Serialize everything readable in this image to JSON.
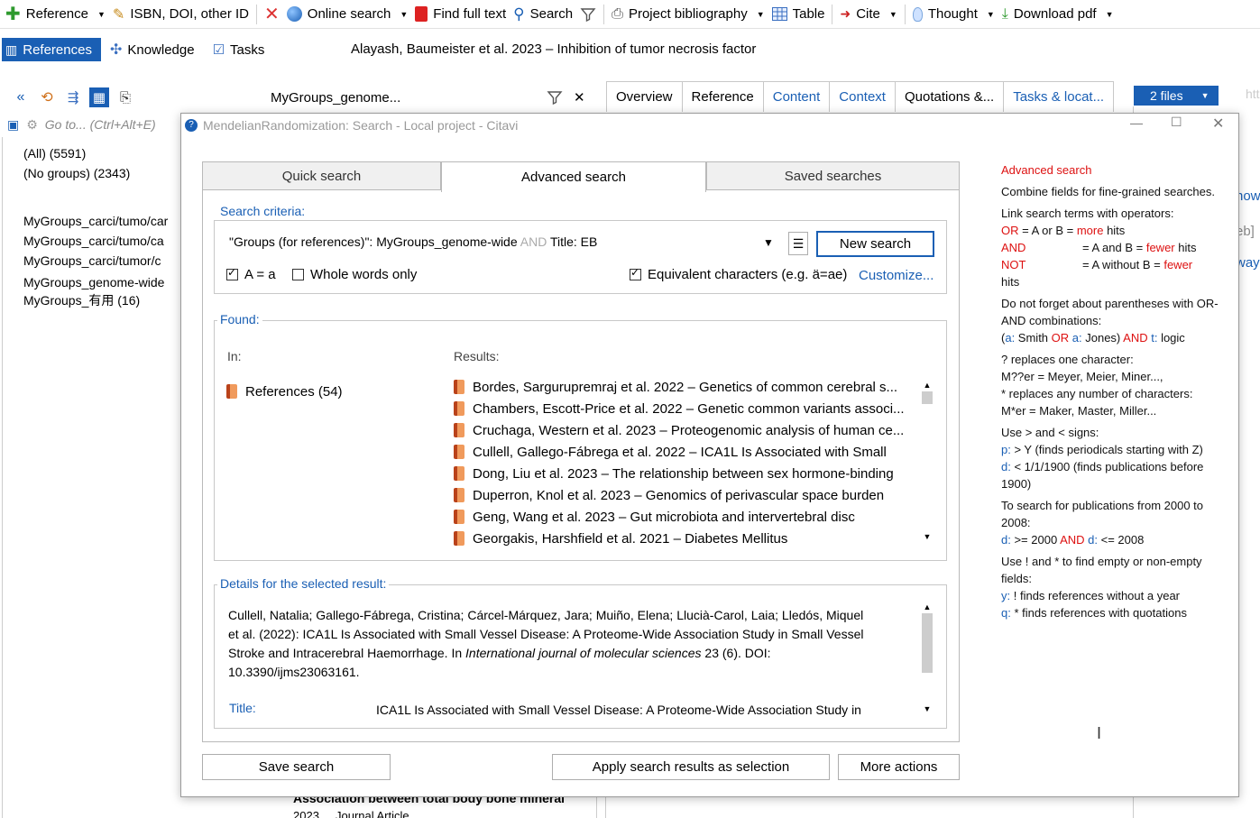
{
  "toolbar": {
    "items": [
      {
        "label": "Reference",
        "icon": "plus-icon",
        "caret": true
      },
      {
        "label": "ISBN, DOI, other ID",
        "icon": "wand-icon",
        "caret": false
      },
      {
        "label": "Online search",
        "icon": "globe-icon",
        "caret": true
      },
      {
        "label": "Find full text",
        "icon": "pdf-icon",
        "caret": false
      },
      {
        "label": "Search",
        "icon": "search-icon",
        "caret": false
      },
      {
        "label": "Project bibliography",
        "icon": "printer-icon",
        "caret": true
      },
      {
        "label": "Table",
        "icon": "table-icon",
        "caret": false
      },
      {
        "label": "Cite",
        "icon": "cite-icon",
        "caret": true
      },
      {
        "label": "Thought",
        "icon": "bulb-icon",
        "caret": true
      },
      {
        "label": "Download pdf",
        "icon": "download-icon",
        "caret": true
      }
    ]
  },
  "nav": {
    "references": "References",
    "knowledge": "Knowledge",
    "tasks": "Tasks",
    "reference_title": "Alayash, Baumeister et al. 2023 – Inhibition of tumor necrosis factor"
  },
  "left": {
    "goto_placeholder": "Go to... (Ctrl+Alt+E)",
    "groups": [
      "(All) (5591)",
      "(No groups) (2343)",
      "",
      "MyGroups_carci/tumo/car",
      "MyGroups_carci/tumo/ca",
      "MyGroups_carci/tumor/c",
      "MyGroups_genome-wide",
      "MyGroups_有用 (16)"
    ]
  },
  "filter": {
    "value": "MyGroups_genome..."
  },
  "tabs": [
    "Overview",
    "Reference",
    "Content",
    "Context",
    "Quotations &...",
    "Tasks & locat..."
  ],
  "files": {
    "label": "2 files"
  },
  "right_peek": {
    "top": "htt"
  },
  "right_peek_lines": [
    "now",
    "eb]",
    "way"
  ],
  "dialog": {
    "title": "MendelianRandomization: Search - Local project - Citavi",
    "tabs": {
      "quick": "Quick search",
      "advanced": "Advanced search",
      "saved": "Saved searches"
    },
    "criteria": {
      "legend": "Search criteria:",
      "query_part1": "\"Groups (for references)\": MyGroups_genome-wide ",
      "query_op": "AND",
      "query_part2": " Title: EB",
      "new_search": "New search",
      "case_label": "A = a",
      "whole_words": "Whole words only",
      "equivalent": "Equivalent characters (e.g. ä=ae)",
      "customize": "Customize..."
    },
    "found": {
      "legend": "Found:",
      "in_header": "In:",
      "results_header": "Results:",
      "in_item": "References (54)",
      "results": [
        "Bordes, Sarguruprem­raj et al. 2022 – Genetics of common cerebral s...",
        "Chambers, Escott-Price et al. 2022 – Genetic common variants associ...",
        "Cruchaga, Western et al. 2023 – Proteogenomic analysis of human ce...",
        "Cullell, Gallego-Fábrega et al. 2022 – ICA1L Is Associated with Small",
        "Dong, Liu et al. 2023 – The relationship between sex hormone-binding",
        "Duperron, Knol et al. 2023 – Genomics of perivascular space burden",
        "Geng, Wang et al. 2023 – Gut microbiota and intervertebral disc",
        "Georgakis, Harshfield et al. 2021 – Diabetes Mellitus"
      ]
    },
    "details": {
      "legend": "Details for the selected result:",
      "line1": "Cullell, Natalia; Gallego-Fábrega, Cristina; Cárcel-Márquez, Jara; Muiño, Elena; Llucià-Carol, Laia; Lledós, Miquel",
      "line2": "et al. (2022): ICA1L Is Associated with Small Vessel Disease: A Proteome-Wide Association Study in Small Vessel",
      "line3a": "Stroke and Intracerebral Haemorrhage. In ",
      "line3b": "International journal of molecular sciences",
      "line3c": " 23 (6). DOI:",
      "line4": "10.3390/ijms23063161.",
      "title_label": "Title:",
      "title_value": "ICA1L Is Associated with Small Vessel Disease: A Proteome-Wide Association Study in"
    },
    "buttons": {
      "save": "Save search",
      "apply": "Apply search results as selection",
      "more": "More actions"
    }
  },
  "bottom_peek": {
    "line1": "Association between total body bone mineral",
    "line2": "2023 ... Journal Article"
  },
  "help": {
    "title": "Advanced search",
    "intro": "Combine fields for fine-grained searches.",
    "link": "Link search terms with operators:",
    "or_op": "OR",
    "or_eq1": " = A or B = ",
    "or_more": "more",
    "or_hits": " hits",
    "and_op": "AND",
    "and_eq": "= A and B = ",
    "and_fewer": "fewer",
    "and_hits": " hits",
    "not_op": "NOT",
    "not_eq": "= A without B = ",
    "not_fewer": "fewer",
    "not_hits": "hits",
    "paren": "Do not forget about parentheses with OR-AND combinations:",
    "paren_ex_a": "a:",
    "paren_ex_1": " Smith ",
    "paren_ex_or": "OR",
    "paren_ex_a2": " a:",
    "paren_ex_2": " Jones) ",
    "paren_ex_and": "AND",
    "paren_ex_t": " t:",
    "paren_ex_3": " logic",
    "q1": "? replaces one character:",
    "q1_ex": "M??er = Meyer, Meier, Miner...,",
    "q2": "* replaces any number of characters:",
    "q2_ex": "M*er = Maker, Master, Miller...",
    "gt": "Use > and < signs:",
    "gt_ex1_p": "p:",
    "gt_ex1": " > Y (finds periodicals starting with Z)",
    "gt_ex2_d": "d:",
    "gt_ex2": " < 1/1/1900 (finds publications before 1900)",
    "range": "To search for publications from 2000 to 2008:",
    "range_ex_d1": "d:",
    "range_ex_1": " >= 2000 ",
    "range_ex_and": "AND",
    "range_ex_d2": " d:",
    "range_ex_2": " <= 2008",
    "empty": "Use ! and * to find empty or non-empty fields:",
    "empty_ex1_y": "y:",
    "empty_ex1": " ! finds references without a year",
    "empty_ex2_q": "q:",
    "empty_ex2": " * finds references with quotations"
  }
}
